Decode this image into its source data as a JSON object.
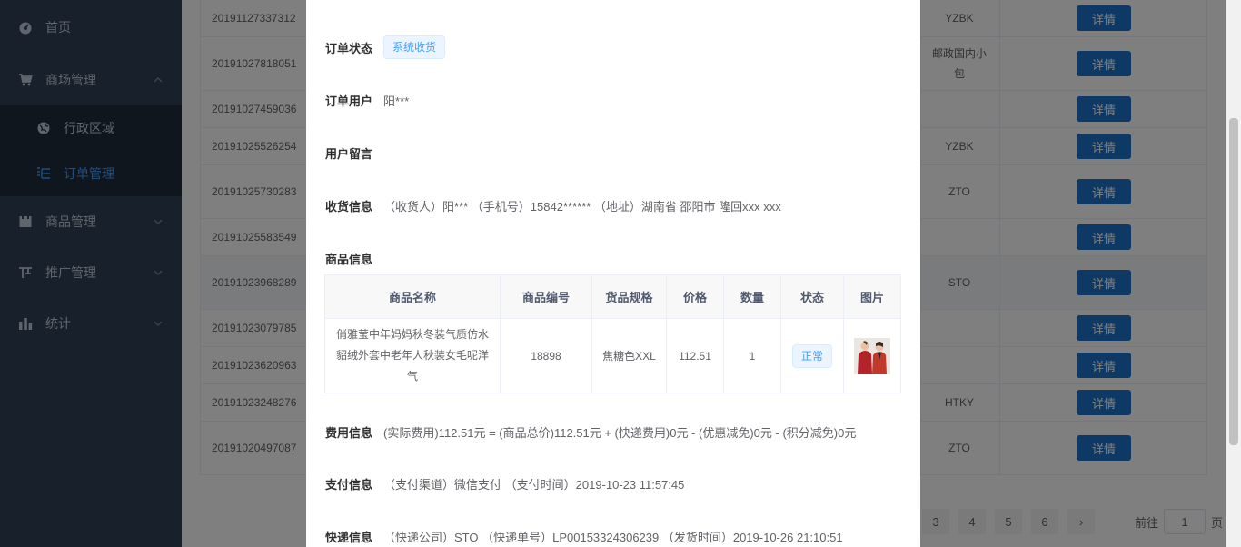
{
  "sidebar": {
    "items": [
      {
        "label": "首页",
        "icon": "dashboard-icon"
      },
      {
        "label": "商场管理",
        "icon": "cart-icon"
      },
      {
        "label": "商品管理",
        "icon": "box-icon"
      },
      {
        "label": "推广管理",
        "icon": "promote-icon"
      },
      {
        "label": "统计",
        "icon": "chart-icon"
      }
    ],
    "sub_items": [
      {
        "label": "行政区域",
        "icon": "globe-icon"
      },
      {
        "label": "订单管理",
        "icon": "list-icon"
      }
    ]
  },
  "orders": [
    {
      "id": "20191127337312",
      "carrier": "YZBK",
      "btn": "详情"
    },
    {
      "id": "20191027818051",
      "carrier": "邮政国内小包",
      "btn": "详情"
    },
    {
      "id": "20191027459036",
      "carrier": "",
      "btn": "详情"
    },
    {
      "id": "20191025526254",
      "carrier": "YZBK",
      "btn": "详情"
    },
    {
      "id": "20191025730283",
      "carrier": "ZTO",
      "btn": "详情"
    },
    {
      "id": "20191025583549",
      "carrier": "",
      "btn": "详情"
    },
    {
      "id": "20191023968289",
      "carrier": "STO",
      "btn": "详情"
    },
    {
      "id": "20191023079785",
      "carrier": "",
      "btn": "详情"
    },
    {
      "id": "20191023620963",
      "carrier": "",
      "btn": "详情"
    },
    {
      "id": "20191023248276",
      "carrier": "HTKY",
      "btn": "详情"
    },
    {
      "id": "20191020497087",
      "carrier": "ZTO",
      "btn": "详情"
    }
  ],
  "pager": {
    "pages": [
      "3",
      "4",
      "5",
      "6"
    ],
    "next": "›",
    "goto_prefix": "前往",
    "goto_value": "1",
    "goto_suffix": "页"
  },
  "dialog": {
    "status_label": "订单状态",
    "status_tag": "系统收货",
    "user_label": "订单用户",
    "user_value": "阳***",
    "message_label": "用户留言",
    "message_value": "",
    "receiver_label": "收货信息",
    "receiver_value": "（收货人）阳*** （手机号）15842****** （地址）湖南省 邵阳市 隆回xxx xxx",
    "goods_label": "商品信息",
    "goods_headers": [
      "商品名称",
      "商品编号",
      "货品规格",
      "价格",
      "数量",
      "状态",
      "图片"
    ],
    "goods_row": {
      "name": "俏雅莹中年妈妈秋冬装气质仿水貂绒外套中老年人秋装女毛呢洋气",
      "sn": "18898",
      "spec": "焦糖色XXL",
      "price": "112.51",
      "qty": "1",
      "status": "正常"
    },
    "fee_label": "费用信息",
    "fee_value": "(实际费用)112.51元 = (商品总价)112.51元 + (快递费用)0元 - (优惠减免)0元 - (积分减免)0元",
    "pay_label": "支付信息",
    "pay_value": "（支付渠道）微信支付 （支付时间）2019-10-23 11:57:45",
    "ship_label": "快递信息",
    "ship_value": "（快递公司）STO （快递单号）LP00153324306239 （发货时间）2019-10-26 21:10:51"
  },
  "colors": {
    "sidebar_bg": "#304156",
    "submenu_bg": "#1f2d3d",
    "active": "#409eff",
    "button": "#1a73c8"
  }
}
